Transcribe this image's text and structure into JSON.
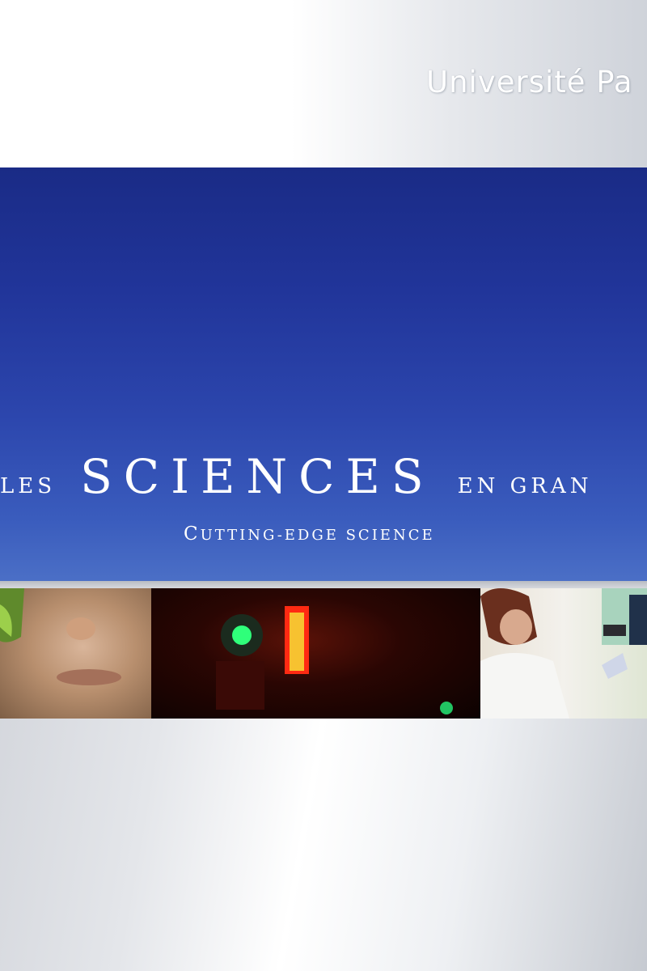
{
  "header": {
    "university_name": "Université Pa"
  },
  "hero": {
    "title_prefix": "Les",
    "title_main": "SCIENCES",
    "title_suffix": "en gran",
    "subtitle_first_letter": "C",
    "subtitle_rest": "utting-edge science"
  },
  "colors": {
    "hero_sky": "#21359a",
    "page_background": "#e4e6ea",
    "text_light": "#ffffff"
  },
  "icons": [
    "university-logo-text"
  ]
}
